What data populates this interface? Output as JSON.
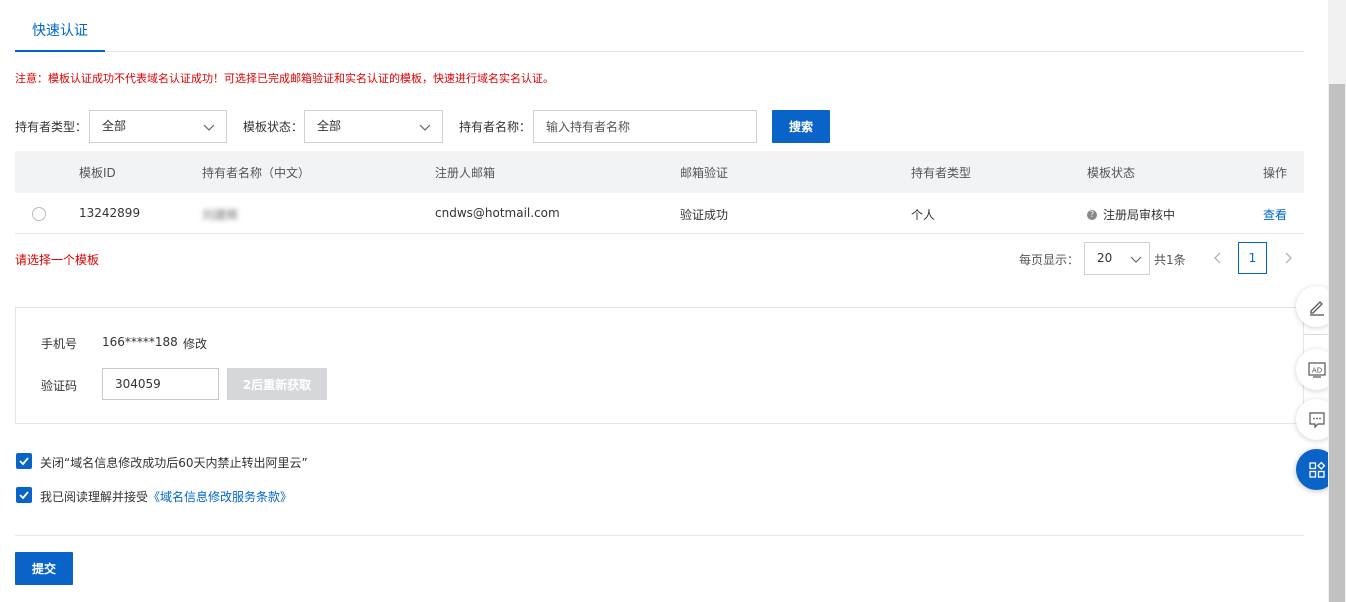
{
  "tabs": {
    "active": "快速认证"
  },
  "notice": "注意：模板认证成功不代表域名认证成功！可选择已完成邮箱验证和实名认证的模板，快速进行域名实名认证。",
  "filters": {
    "holder_type_label": "持有者类型：",
    "holder_type_value": "全部",
    "template_status_label": "模板状态：",
    "template_status_value": "全部",
    "holder_name_label": "持有者名称：",
    "holder_name_placeholder": "输入持有者名称",
    "search_button": "搜索"
  },
  "table": {
    "columns": [
      "模板ID",
      "持有者名称（中文）",
      "注册人邮箱",
      "邮箱验证",
      "持有者类型",
      "模板状态",
      "操作"
    ],
    "rows": [
      {
        "template_id": "13242899",
        "holder_name": "刘建辉",
        "email": "cndws@hotmail.com",
        "email_verify": "验证成功",
        "holder_type": "个人",
        "status": "注册局审核中",
        "action": "查看"
      }
    ]
  },
  "select_tip": "请选择一个模板",
  "pagination": {
    "per_page_label": "每页显示：",
    "per_page_value": "20",
    "total_text": "共1条",
    "current_page": "1"
  },
  "verification": {
    "phone_label": "手机号",
    "phone_value": "166*****188",
    "modify_link": "修改",
    "code_label": "验证码",
    "code_value": "304059",
    "resend_button": "2后重新获取"
  },
  "agreements": {
    "close_lock_text": "关闭“域名信息修改成功后60天内禁止转出阿里云”",
    "terms_prefix": "我已阅读理解并接受",
    "terms_link": "《域名信息修改服务条款》"
  },
  "submit_button": "提交",
  "float_tools": [
    "edit-icon",
    "ad-icon",
    "feedback-icon",
    "apps-icon"
  ],
  "colors": {
    "primary": "#0a64c8",
    "warning": "#e00000",
    "link": "#0066cc"
  }
}
